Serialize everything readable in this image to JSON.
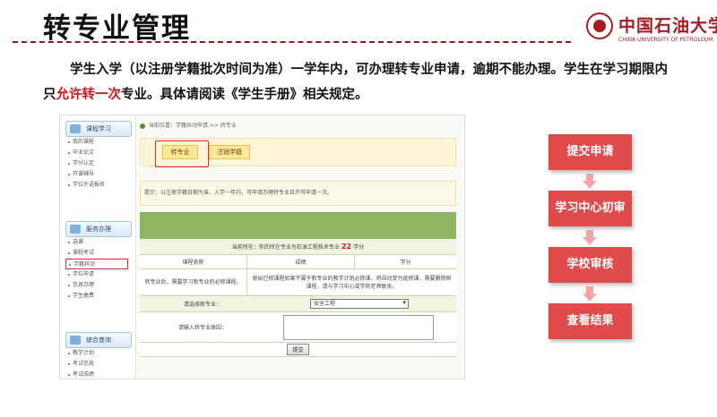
{
  "slide": {
    "title": "转专业管理",
    "logo_cn": "中国石油大学",
    "logo_en": "CHINA UNIVERSITY OF PETROLEUM"
  },
  "intro": {
    "part1": "学生入学（以注册学籍批次时间为准）一学年内，可办理转专业申请，逾期不能办理。学生在学习期限内只",
    "highlight": "允许转一次",
    "part2": "专业。具体请阅读《学生手册》相关规定。"
  },
  "screenshot": {
    "sidebar": {
      "sections": [
        {
          "title": "课程学习",
          "items": [
            "我的课程",
            "毕业论文",
            "学分认定",
            "开课辅导",
            "学位外语报名"
          ]
        },
        {
          "title": "服务办理",
          "items": [
            "选课",
            "课程考试",
            "学籍异动",
            "学位申请",
            "信息办理",
            "学生缴费"
          ]
        },
        {
          "title": "综合查询",
          "items": [
            "教学计划",
            "考试信息",
            "考试成绩"
          ]
        }
      ],
      "active_item": "学籍异动"
    },
    "breadcrumb": "当前位置：学籍异动申请 >> 转专业",
    "tabs": [
      "转专业",
      "注销学籍"
    ],
    "notice": "提示：以注册学籍日期为准，入学一年内，可申请办理转专业且只可申请一次。",
    "form": {
      "header_prefix": "当前所在：你的所在专业为石油工程技术专业",
      "header_count": "22",
      "header_suffix": "学分",
      "col_course": "课程名称",
      "col_score": "成绩",
      "col_credit": "学分",
      "row_course": "转专业后，需要学习新专业的必修课程。",
      "row_note": "原始已修课程如果不属于新专业的教学计划必修课，将自动变为选修课，需要删除原课程，请与学习中心或学院老师联系。",
      "select_label": "请选择新专业：",
      "select_value": "安全工程",
      "reason_label": "请输入转专业原因：",
      "submit_label": "提交"
    }
  },
  "flow": {
    "steps": [
      "提交申请",
      "学习中心初审",
      "学校审核",
      "查看结果"
    ]
  },
  "colors": {
    "accent_red": "#d4121b",
    "flow_box": "#e04a4a",
    "flow_arrow": "#f1a5a5",
    "title_rule": "#8c1c24"
  }
}
